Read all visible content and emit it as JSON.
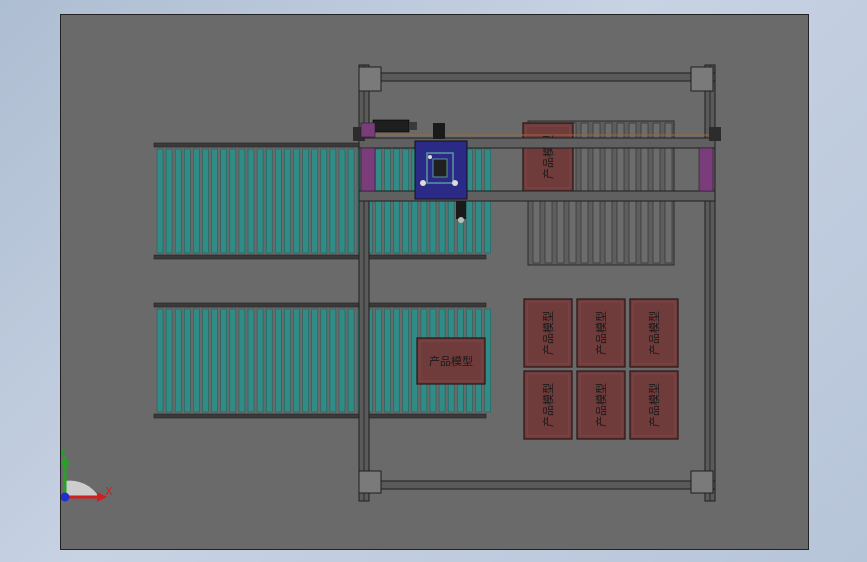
{
  "scene": {
    "colors": {
      "background": "#6a6a6a",
      "conveyor_frame": "#3f3f3f",
      "roller": "#2f8c86",
      "roller_dark": "#235f5c",
      "box": "#6f3b3b",
      "gantry": "#2c2c2c",
      "carriage": "#2a2a8a",
      "pallet": "#555555",
      "accent_purple": "#7a3c7a"
    },
    "box_label": "产品模型",
    "axis": {
      "x_label": "X",
      "y_label": "Y"
    }
  }
}
